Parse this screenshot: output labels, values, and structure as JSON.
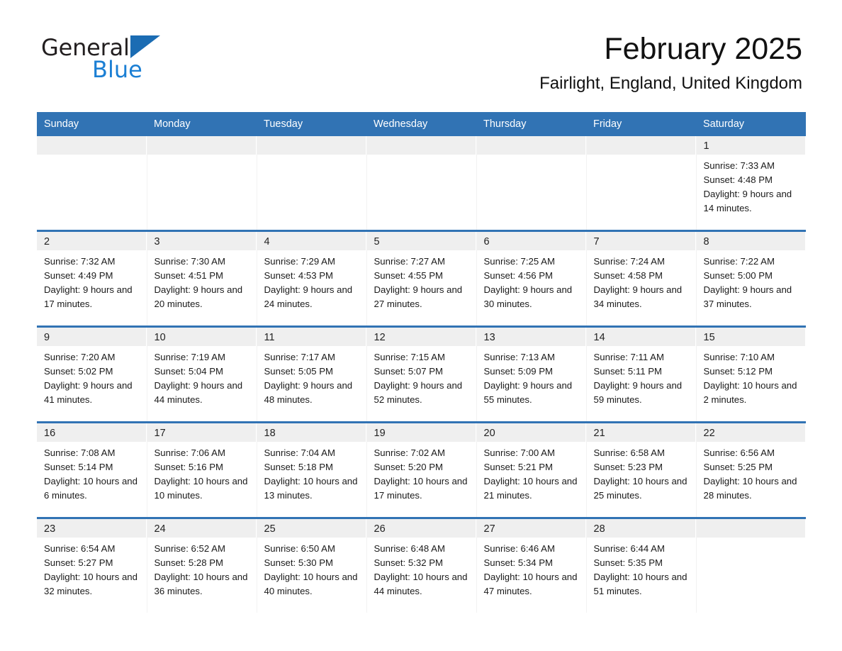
{
  "brand": {
    "name_part1": "General",
    "name_part2": "Blue",
    "logo_icon": "triangle-logo-icon",
    "accent_color": "#1b6cb3"
  },
  "header": {
    "title": "February 2025",
    "location": "Fairlight, England, United Kingdom"
  },
  "theme": {
    "header_blue": "#3173b4",
    "daynum_band": "#efefef",
    "text": "#1a1a1a"
  },
  "weekdays": [
    "Sunday",
    "Monday",
    "Tuesday",
    "Wednesday",
    "Thursday",
    "Friday",
    "Saturday"
  ],
  "weeks": [
    [
      {
        "day": "",
        "empty": true
      },
      {
        "day": "",
        "empty": true
      },
      {
        "day": "",
        "empty": true
      },
      {
        "day": "",
        "empty": true
      },
      {
        "day": "",
        "empty": true
      },
      {
        "day": "",
        "empty": true
      },
      {
        "day": "1",
        "sunrise": "Sunrise: 7:33 AM",
        "sunset": "Sunset: 4:48 PM",
        "daylight": "Daylight: 9 hours and 14 minutes."
      }
    ],
    [
      {
        "day": "2",
        "sunrise": "Sunrise: 7:32 AM",
        "sunset": "Sunset: 4:49 PM",
        "daylight": "Daylight: 9 hours and 17 minutes."
      },
      {
        "day": "3",
        "sunrise": "Sunrise: 7:30 AM",
        "sunset": "Sunset: 4:51 PM",
        "daylight": "Daylight: 9 hours and 20 minutes."
      },
      {
        "day": "4",
        "sunrise": "Sunrise: 7:29 AM",
        "sunset": "Sunset: 4:53 PM",
        "daylight": "Daylight: 9 hours and 24 minutes."
      },
      {
        "day": "5",
        "sunrise": "Sunrise: 7:27 AM",
        "sunset": "Sunset: 4:55 PM",
        "daylight": "Daylight: 9 hours and 27 minutes."
      },
      {
        "day": "6",
        "sunrise": "Sunrise: 7:25 AM",
        "sunset": "Sunset: 4:56 PM",
        "daylight": "Daylight: 9 hours and 30 minutes."
      },
      {
        "day": "7",
        "sunrise": "Sunrise: 7:24 AM",
        "sunset": "Sunset: 4:58 PM",
        "daylight": "Daylight: 9 hours and 34 minutes."
      },
      {
        "day": "8",
        "sunrise": "Sunrise: 7:22 AM",
        "sunset": "Sunset: 5:00 PM",
        "daylight": "Daylight: 9 hours and 37 minutes."
      }
    ],
    [
      {
        "day": "9",
        "sunrise": "Sunrise: 7:20 AM",
        "sunset": "Sunset: 5:02 PM",
        "daylight": "Daylight: 9 hours and 41 minutes."
      },
      {
        "day": "10",
        "sunrise": "Sunrise: 7:19 AM",
        "sunset": "Sunset: 5:04 PM",
        "daylight": "Daylight: 9 hours and 44 minutes."
      },
      {
        "day": "11",
        "sunrise": "Sunrise: 7:17 AM",
        "sunset": "Sunset: 5:05 PM",
        "daylight": "Daylight: 9 hours and 48 minutes."
      },
      {
        "day": "12",
        "sunrise": "Sunrise: 7:15 AM",
        "sunset": "Sunset: 5:07 PM",
        "daylight": "Daylight: 9 hours and 52 minutes."
      },
      {
        "day": "13",
        "sunrise": "Sunrise: 7:13 AM",
        "sunset": "Sunset: 5:09 PM",
        "daylight": "Daylight: 9 hours and 55 minutes."
      },
      {
        "day": "14",
        "sunrise": "Sunrise: 7:11 AM",
        "sunset": "Sunset: 5:11 PM",
        "daylight": "Daylight: 9 hours and 59 minutes."
      },
      {
        "day": "15",
        "sunrise": "Sunrise: 7:10 AM",
        "sunset": "Sunset: 5:12 PM",
        "daylight": "Daylight: 10 hours and 2 minutes."
      }
    ],
    [
      {
        "day": "16",
        "sunrise": "Sunrise: 7:08 AM",
        "sunset": "Sunset: 5:14 PM",
        "daylight": "Daylight: 10 hours and 6 minutes."
      },
      {
        "day": "17",
        "sunrise": "Sunrise: 7:06 AM",
        "sunset": "Sunset: 5:16 PM",
        "daylight": "Daylight: 10 hours and 10 minutes."
      },
      {
        "day": "18",
        "sunrise": "Sunrise: 7:04 AM",
        "sunset": "Sunset: 5:18 PM",
        "daylight": "Daylight: 10 hours and 13 minutes."
      },
      {
        "day": "19",
        "sunrise": "Sunrise: 7:02 AM",
        "sunset": "Sunset: 5:20 PM",
        "daylight": "Daylight: 10 hours and 17 minutes."
      },
      {
        "day": "20",
        "sunrise": "Sunrise: 7:00 AM",
        "sunset": "Sunset: 5:21 PM",
        "daylight": "Daylight: 10 hours and 21 minutes."
      },
      {
        "day": "21",
        "sunrise": "Sunrise: 6:58 AM",
        "sunset": "Sunset: 5:23 PM",
        "daylight": "Daylight: 10 hours and 25 minutes."
      },
      {
        "day": "22",
        "sunrise": "Sunrise: 6:56 AM",
        "sunset": "Sunset: 5:25 PM",
        "daylight": "Daylight: 10 hours and 28 minutes."
      }
    ],
    [
      {
        "day": "23",
        "sunrise": "Sunrise: 6:54 AM",
        "sunset": "Sunset: 5:27 PM",
        "daylight": "Daylight: 10 hours and 32 minutes."
      },
      {
        "day": "24",
        "sunrise": "Sunrise: 6:52 AM",
        "sunset": "Sunset: 5:28 PM",
        "daylight": "Daylight: 10 hours and 36 minutes."
      },
      {
        "day": "25",
        "sunrise": "Sunrise: 6:50 AM",
        "sunset": "Sunset: 5:30 PM",
        "daylight": "Daylight: 10 hours and 40 minutes."
      },
      {
        "day": "26",
        "sunrise": "Sunrise: 6:48 AM",
        "sunset": "Sunset: 5:32 PM",
        "daylight": "Daylight: 10 hours and 44 minutes."
      },
      {
        "day": "27",
        "sunrise": "Sunrise: 6:46 AM",
        "sunset": "Sunset: 5:34 PM",
        "daylight": "Daylight: 10 hours and 47 minutes."
      },
      {
        "day": "28",
        "sunrise": "Sunrise: 6:44 AM",
        "sunset": "Sunset: 5:35 PM",
        "daylight": "Daylight: 10 hours and 51 minutes."
      },
      {
        "day": "",
        "empty": true
      }
    ]
  ]
}
